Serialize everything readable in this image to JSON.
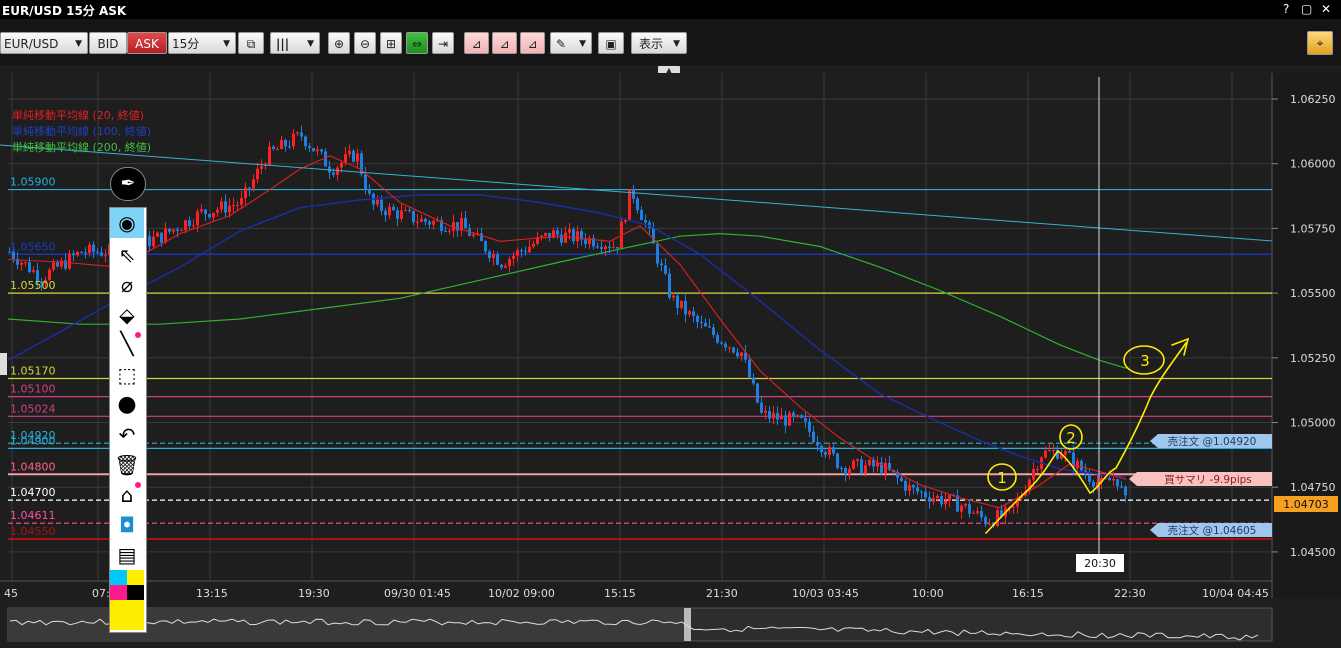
{
  "window": {
    "title": "EUR/USD 15分 ASK",
    "help": "?",
    "restore": "▢",
    "close": "✕"
  },
  "toolbar": {
    "symbol": "EUR/USD",
    "bid_label": "BID",
    "ask_label": "ASK",
    "timeframe": "15分",
    "display_label": "表示",
    "icons": [
      "link-icon",
      "bar-chart-icon",
      "zoom-in-icon",
      "zoom-out-icon",
      "fit-icon",
      "expand-icon",
      "scroll-end-icon",
      "add-order-icon",
      "edit-order-icon",
      "cancel-order-icon",
      "pen-icon",
      "screenshot-icon",
      "target-icon"
    ]
  },
  "legend": {
    "ma20": "単純移動平均線 (20, 終値)",
    "ma100": "単純移動平均線 (100, 終値)",
    "ma200": "単純移動平均線 (200, 終値)"
  },
  "colors": {
    "background": "#1e1e1e",
    "grid": "#3a3a3a",
    "candle_up": "#ff2020",
    "candle_down": "#1f7fe0",
    "ma20": "#e02020",
    "ma100": "#1a2ea8",
    "ma200": "#30b030",
    "annotation": "#ffee00"
  },
  "price_axis": {
    "ticks": [
      "1.06250",
      "1.06000",
      "1.05750",
      "1.05500",
      "1.05250",
      "1.05000",
      "1.04750",
      "1.04500"
    ],
    "current": "1.04703"
  },
  "time_axis": {
    "ticks": [
      "45",
      "07:",
      "13:15",
      "19:30",
      "09/30 01:45",
      "10/02 09:00",
      "15:15",
      "21:30",
      "10/03 03:45",
      "10:00",
      "16:15",
      "22:30",
      "10/04 04:45"
    ],
    "crosshair": "20:30"
  },
  "levels": [
    {
      "label": "1.05900",
      "color": "#2ab0d8"
    },
    {
      "label": "1.05650",
      "color": "#1a3acc"
    },
    {
      "label": "1.05500",
      "color": "#d6d63a"
    },
    {
      "label": "1.05170",
      "color": "#d6d63a"
    },
    {
      "label": "1.05100",
      "color": "#d04080"
    },
    {
      "label": "1.05024",
      "color": "#d04080"
    },
    {
      "label": "1.04920",
      "color": "#2ab0d8"
    },
    {
      "label": "1.04900",
      "color": "#2ab0d8"
    },
    {
      "label": "1.04800",
      "color": "#ff6090"
    },
    {
      "label": "1.04700",
      "color": "#ffffff"
    },
    {
      "label": "1.04611",
      "color": "#ff4fa0"
    },
    {
      "label": "1.04550",
      "color": "#aa1010"
    }
  ],
  "orders": {
    "sell_upper": "売注文 @1.04920",
    "position": "買サマリ -9.9pips",
    "sell_lower": "売注文 @1.04605"
  },
  "annotations": {
    "n1": "1",
    "n2": "2",
    "n3": "3"
  },
  "drawing_tools": [
    "pen-icon",
    "eye-icon",
    "cursor-icon",
    "magnet-icon",
    "eraser-icon",
    "line-icon",
    "ruler-icon",
    "dot-icon",
    "undo-icon",
    "trash-icon",
    "stamp-icon",
    "camera-icon",
    "clipboard-icon",
    "palette-icon"
  ]
}
